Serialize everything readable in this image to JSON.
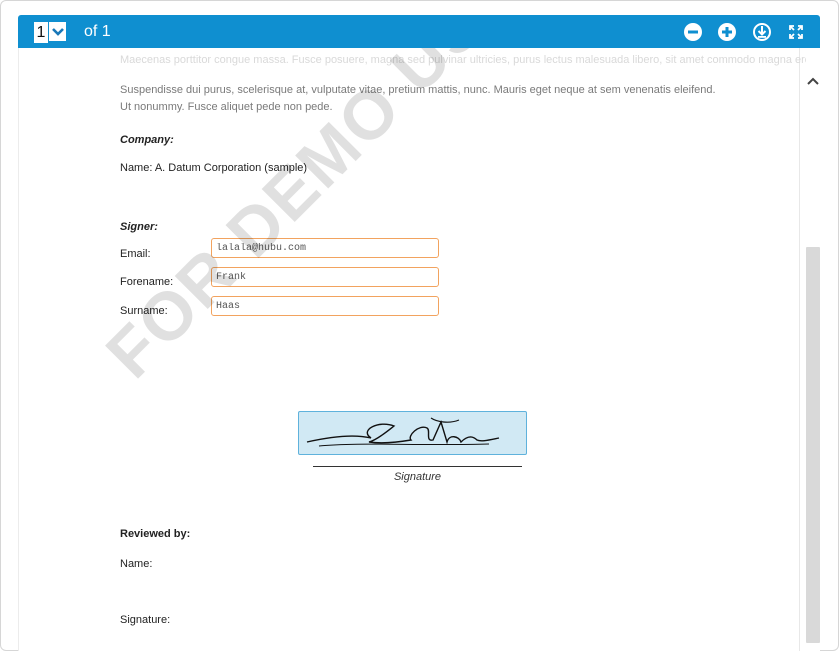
{
  "toolbar": {
    "page_current": "1",
    "page_of": "of 1",
    "buttons": [
      {
        "name": "zoom-out-icon"
      },
      {
        "name": "zoom-in-icon"
      },
      {
        "name": "download-icon"
      },
      {
        "name": "fullscreen-icon"
      }
    ],
    "color": "#0f8fd0"
  },
  "document": {
    "faded_line": "Maecenas porttitor congue massa. Fusce posuere, magna sed pulvinar ultricies, purus lectus malesuada libero, sit amet commodo magna eros quis urna. Nunc viverra imperdiet enim. Fusce est. Vivamus a tellus. Pellentesque habitant morbi tristique senectus et netus et malesuada fames ac turpis egestas. Proin pharetra nonummy pede.",
    "paragraph": "Suspendisse dui purus, scelerisque at, vulputate vitae, pretium mattis, nunc. Mauris eget neque at sem venenatis eleifend. Ut nonummy. Fusce aliquet pede non pede.",
    "company_label": "Company:",
    "company_name": "Name: A. Datum Corporation (sample)",
    "signer_label": "Signer:",
    "email_label": "Email:",
    "email_value": "lalala@hubu.com",
    "forename_label": "Forename:",
    "forename_value": "Frank",
    "surname_label": "Surname:",
    "surname_value": "Haas",
    "signature_caption": "Signature",
    "reviewed_label": "Reviewed by:",
    "reviewed_name_label": "Name:",
    "reviewed_signature_label": "Signature:",
    "watermark": "FOR DEMO USE ONLY"
  },
  "colors": {
    "field_border": "#f2a35f",
    "signature_fill": "#d1e9f4",
    "signature_border": "#5fb2dc"
  }
}
